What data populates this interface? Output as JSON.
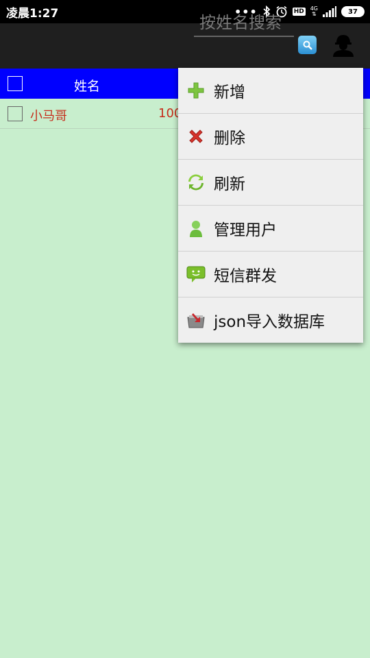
{
  "status_bar": {
    "time": "凌晨1:27",
    "dots": "•••",
    "hd": "HD",
    "network_top": "4G",
    "battery": "37"
  },
  "action_bar": {
    "search_placeholder": "按姓名搜索"
  },
  "table": {
    "header": {
      "name": "姓名"
    },
    "rows": [
      {
        "name": "小马哥",
        "number": "100"
      }
    ]
  },
  "menu": {
    "items": [
      {
        "label": "新增",
        "icon": "plus-icon"
      },
      {
        "label": "删除",
        "icon": "delete-x-icon"
      },
      {
        "label": "刷新",
        "icon": "refresh-icon"
      },
      {
        "label": "管理用户",
        "icon": "user-icon"
      },
      {
        "label": "短信群发",
        "icon": "sms-icon"
      },
      {
        "label": "json导入数据库",
        "icon": "import-icon"
      }
    ]
  },
  "colors": {
    "background": "#c8eecd",
    "header_blue": "#0000ff",
    "row_text_red": "#c62c1a",
    "action_bar": "#1f1f1f"
  }
}
